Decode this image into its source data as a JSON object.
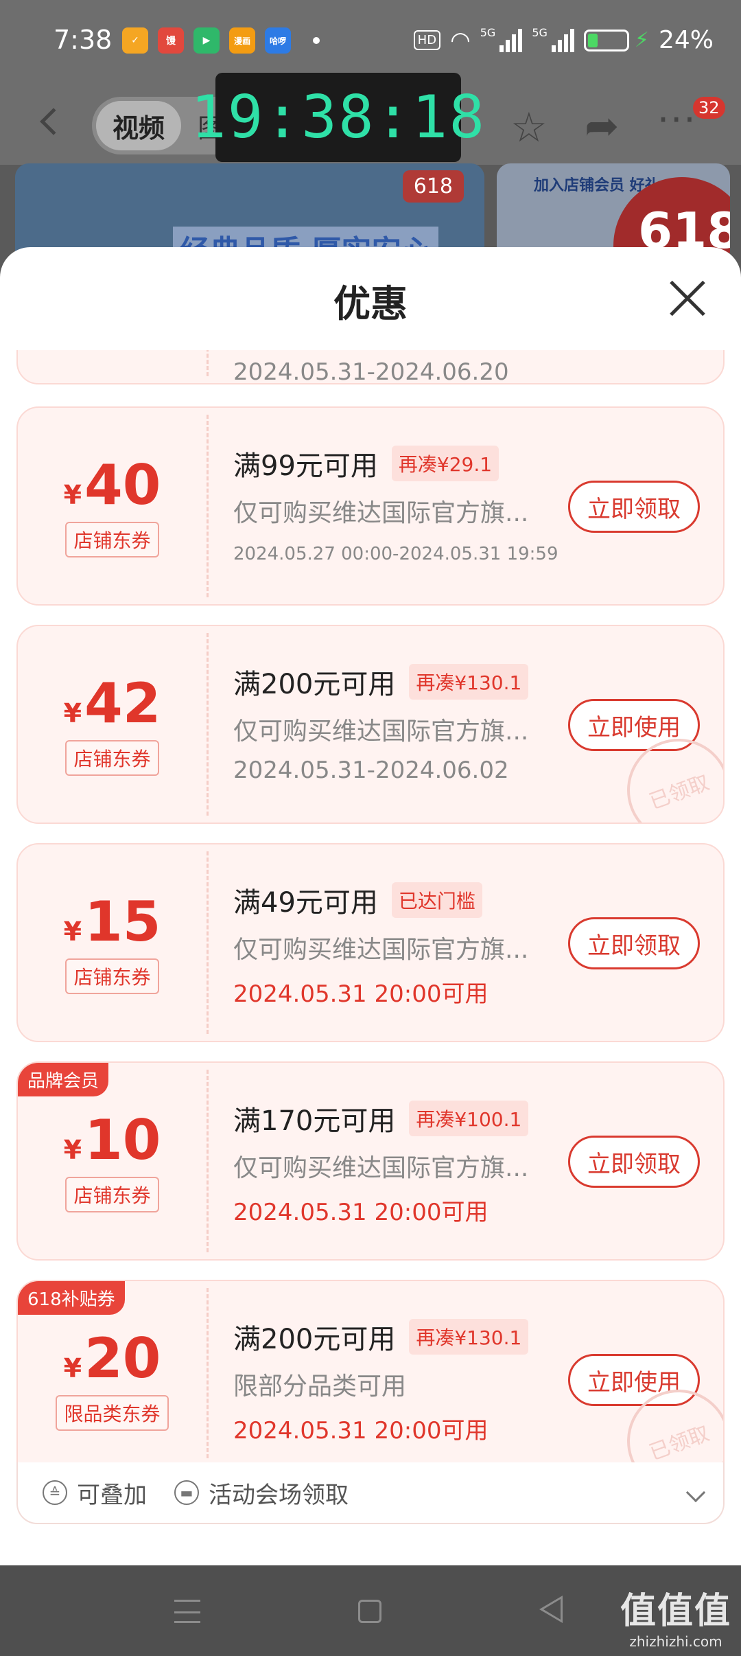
{
  "status_bar": {
    "time": "7:38",
    "apps": [
      {
        "name": "app-orange-icon",
        "label": "",
        "color": "#f5a623"
      },
      {
        "name": "app-mi-icon",
        "label": "馒",
        "color": "#e2483d"
      },
      {
        "name": "app-video-icon",
        "label": "▶",
        "color": "#2fb86a"
      },
      {
        "name": "app-manga-icon",
        "label": "漫画",
        "color": "#f39c12"
      },
      {
        "name": "app-hello-icon",
        "label": "哈啰",
        "color": "#2d7be5"
      }
    ],
    "hd": "HD",
    "net1": "5G",
    "net2": "5G",
    "battery": "24%"
  },
  "page": {
    "tabs": [
      "视频",
      "图"
    ],
    "clock": "19:38:18",
    "more_badge": "32",
    "banner_tag": "618",
    "banner_text": "经典品质 厚实安心",
    "banner2_text": "加入店铺会员 好礼",
    "banner2_big": "618"
  },
  "sheet": {
    "title": "优惠",
    "partial_date": "2024.05.31-2024.06.20",
    "coupons": [
      {
        "amount": "40",
        "kind": "店铺东券",
        "condition": "满99元可用",
        "tip": "再凑¥29.1",
        "desc": "仅可购买维达国际官方旗...",
        "date": "2024.05.27 00:00-2024.05.31 19:59",
        "button": "立即领取",
        "claimed": false
      },
      {
        "amount": "42",
        "kind": "店铺东券",
        "condition": "满200元可用",
        "tip": "再凑¥130.1",
        "desc": "仅可购买维达国际官方旗...",
        "date": "2024.05.31-2024.06.02",
        "button": "立即使用",
        "claimed": true,
        "stamp": "已领取"
      },
      {
        "amount": "15",
        "kind": "店铺东券",
        "condition": "满49元可用",
        "tip": "已达门槛",
        "desc": "仅可购买维达国际官方旗...",
        "date": "2024.05.31 20:00可用",
        "button": "立即领取",
        "claimed": false
      },
      {
        "amount": "10",
        "kind": "店铺东券",
        "condition": "满170元可用",
        "tip": "再凑¥100.1",
        "desc": "仅可购买维达国际官方旗...",
        "date": "2024.05.31 20:00可用",
        "button": "立即领取",
        "claimed": false,
        "corner": "品牌会员"
      },
      {
        "amount": "20",
        "kind": "限品类东券",
        "condition": "满200元可用",
        "tip": "再凑¥130.1",
        "desc": "限部分品类可用",
        "date": "2024.05.31 20:00可用",
        "button": "立即使用",
        "claimed": true,
        "stamp": "已领取",
        "corner": "618补贴券"
      }
    ],
    "footer": {
      "stackable": "可叠加",
      "venue": "活动会场领取"
    }
  },
  "watermark": {
    "line1": "值值值",
    "line2": "zhizhizhi.com"
  },
  "yen": "¥"
}
